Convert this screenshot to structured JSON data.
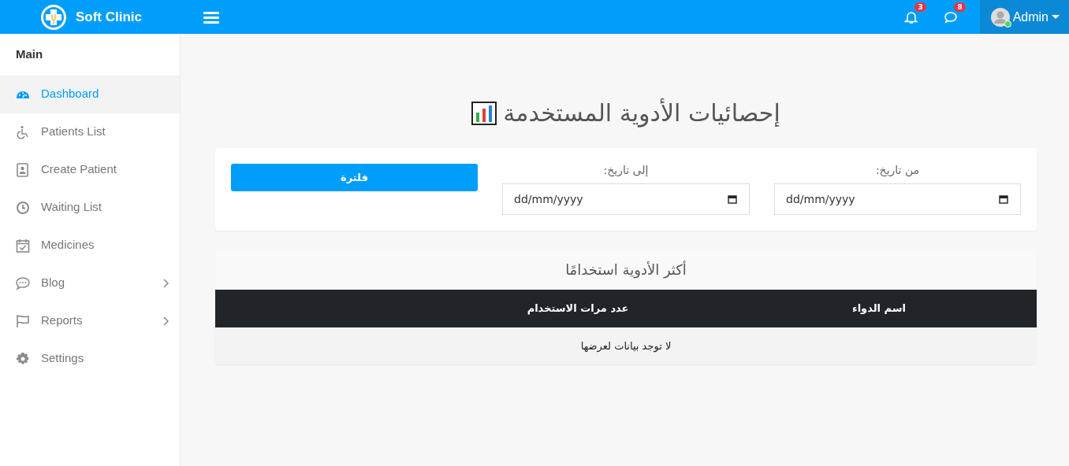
{
  "brand": {
    "name": "Soft Clinic"
  },
  "topbar": {
    "notifications": {
      "count": "3"
    },
    "messages": {
      "count": "8"
    },
    "user": {
      "name": "Admin",
      "online": true
    }
  },
  "sidebar": {
    "heading": "Main",
    "items": [
      {
        "label": "Dashboard",
        "selected": true,
        "submenu": false
      },
      {
        "label": "Patients List",
        "selected": false,
        "submenu": false
      },
      {
        "label": "Create Patient",
        "selected": false,
        "submenu": false
      },
      {
        "label": "Waiting List",
        "selected": false,
        "submenu": false
      },
      {
        "label": "Medicines",
        "selected": false,
        "submenu": false
      },
      {
        "label": "Blog",
        "selected": false,
        "submenu": true
      },
      {
        "label": "Reports",
        "selected": false,
        "submenu": true
      },
      {
        "label": "Settings",
        "selected": false,
        "submenu": false
      }
    ]
  },
  "page": {
    "title": "إحصائيات الأدوية المستخدمة"
  },
  "filter": {
    "from": {
      "label": "من تاريخ:",
      "placeholder": "dd/mm/yyyy"
    },
    "to": {
      "label": "إلى تاريخ:",
      "placeholder": "dd/mm/yyyy"
    },
    "button": "فلترة"
  },
  "table": {
    "title": "أكثر الأدوية استخدامًا",
    "columns": [
      "اسم الدواء",
      "عدد مرات الاستخدام"
    ],
    "empty_message": "لا توجد بيانات لعرضها"
  }
}
